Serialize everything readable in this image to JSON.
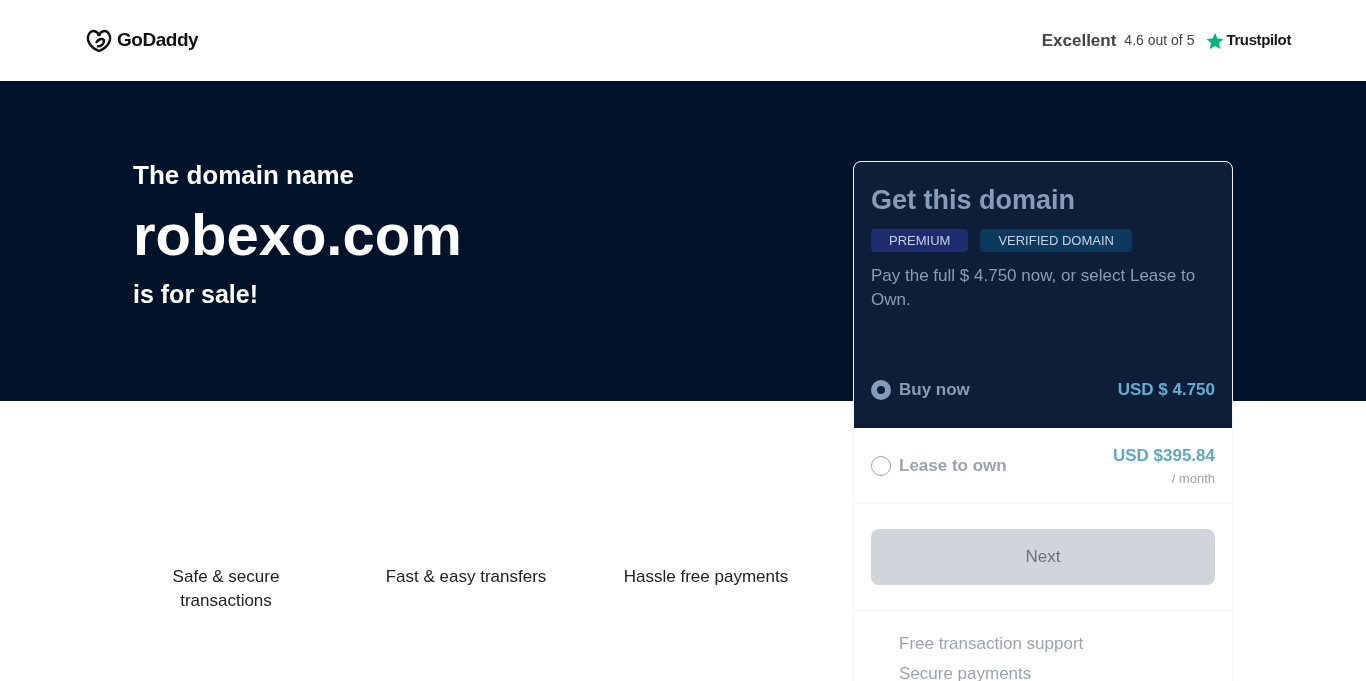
{
  "header": {
    "logo": "GoDaddy",
    "rating": {
      "label": "Excellent",
      "score": "4.6 out of 5",
      "brand": "Trustpilot"
    }
  },
  "hero": {
    "intro": "The domain name",
    "domain": "robexo.com",
    "outro": "is for sale!"
  },
  "features": [
    {
      "label": "Safe & secure transactions"
    },
    {
      "label": "Fast & easy transfers"
    },
    {
      "label": "Hassle free payments"
    }
  ],
  "card": {
    "title": "Get this domain",
    "badges": [
      {
        "label": "PREMIUM",
        "color": "#1e2b6e"
      },
      {
        "label": "VERIFIED DOMAIN",
        "color": "#0c3a5e"
      }
    ],
    "description": "Pay the full $ 4.750 now, or select Lease to Own.",
    "options": [
      {
        "label": "Buy now",
        "price": "USD $ 4.750",
        "selected": true
      },
      {
        "label": "Lease to own",
        "price": "USD $395.84",
        "period": "/ month",
        "selected": false
      }
    ],
    "next_button": {
      "label": "Next",
      "disabled": true
    },
    "benefits": [
      "Free transaction support",
      "Secure payments"
    ]
  }
}
